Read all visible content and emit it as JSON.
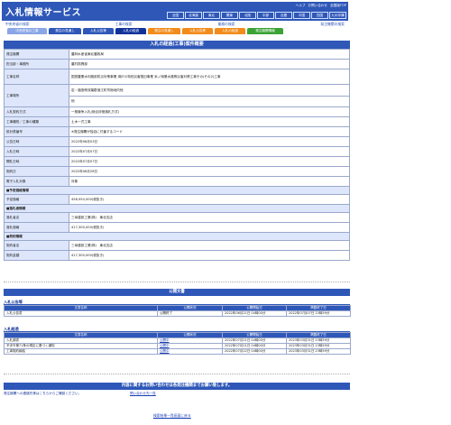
{
  "header": {
    "title": "入札情報サービス",
    "topnav": [
      "ヘルプ",
      "お問い合わせ",
      "全国版TOP"
    ],
    "regions": [
      "全国",
      "北海道",
      "東北",
      "関東",
      "北陸",
      "中部",
      "近畿",
      "中国",
      "四国",
      "九州沖縄"
    ]
  },
  "subbar": {
    "left": "中央府省の検索",
    "mid1": "工事の検索",
    "mid2": "業務の検索",
    "right": "発注機関の検索"
  },
  "tabs": [
    "中央府省の工事",
    "発注の見通し",
    "入札公告等",
    "入札の経過",
    "発注の見通し",
    "入札公告等",
    "入札の経過",
    "発注機関情報"
  ],
  "main": {
    "title": "入札の経過(工事)案件概要",
    "rows": [
      {
        "k": "発注機関",
        "v": "農林水産省東北農政局"
      },
      {
        "k": "担当部・事務所",
        "v": "農村振興部"
      },
      {
        "k": "工事名称",
        "v": "国営農業水利施設防災対策事業 鴻戸川特別災害復旧事業 米ノ岡第水路等災害対策工事その(その2)工事"
      },
      {
        "k": "工事場所",
        "v": "岩・福島県双葉郡浪江町苅宿地内他"
      },
      {
        "k": "",
        "v": "他"
      },
      {
        "k": "入札契約方式",
        "v": "一般競争入札(総合評価落札方式)"
      },
      {
        "k": "工事種別／工事の種類",
        "v": "土木一式工事"
      },
      {
        "k": "設計書番号",
        "v": "※発注機関が独自に付番するコード"
      },
      {
        "k": "公告日時",
        "v": "2022年06月03日"
      },
      {
        "k": "入札日時",
        "v": "2022年07月07日"
      },
      {
        "k": "開札日時",
        "v": "2022年07月07日"
      },
      {
        "k": "契約日",
        "v": "2022年06月28日"
      },
      {
        "k": "電子入札対象",
        "v": "対象"
      }
    ],
    "group_estimate": "■予定価格情報",
    "estimate_label": "予定価格",
    "estimate_value": "458,950,000(税抜き)",
    "group_bid": "■落札者情報",
    "bidder_label": "落札者名",
    "bidder_value": "三幸建設工業(株)　東北支店",
    "bid_price_label": "落札価格",
    "bid_price_value": "417,300,000(税抜き)",
    "group_contract": "■契約情報",
    "contractor_label": "契約者名",
    "contractor_value": "三幸建設工業(株)　東北支店",
    "contract_price_label": "契約金額",
    "contract_price_value": "417,300,000(税抜き)"
  },
  "public_docs": {
    "title": "公開文書",
    "section1_title": "入札公告等",
    "section2_title": "入札経過",
    "headers": [
      "文書名称",
      "公開状況",
      "公開開始日",
      "掲載終了日"
    ],
    "section1_rows": [
      [
        "入札公告書",
        "公開終了",
        "2022年06月21日 04時00分",
        "2022年07月07日 23時59分"
      ]
    ],
    "section2_rows": [
      [
        "入札調書",
        "公開中",
        "2022年07月21日 04時00分",
        "2023年03月31日 23時59分"
      ],
      [
        "予決令第71条の規定に基づく通知",
        "公開中",
        "2022年07月21日 04時00分",
        "2023年03月31日 23時59分"
      ],
      [
        "工事契約締結",
        "公開中",
        "2022年07月22日 04時00分",
        "2023年03月31日 23時59分"
      ]
    ]
  },
  "inquiry": {
    "title": "内容に関するお問い合わせは各発注機関までお願い致します。",
    "label": "発注機関への連絡先等はこちらからご確認ください。",
    "link": "問い合わせ先一覧"
  },
  "back_link": "検索結果一覧画面に戻る"
}
